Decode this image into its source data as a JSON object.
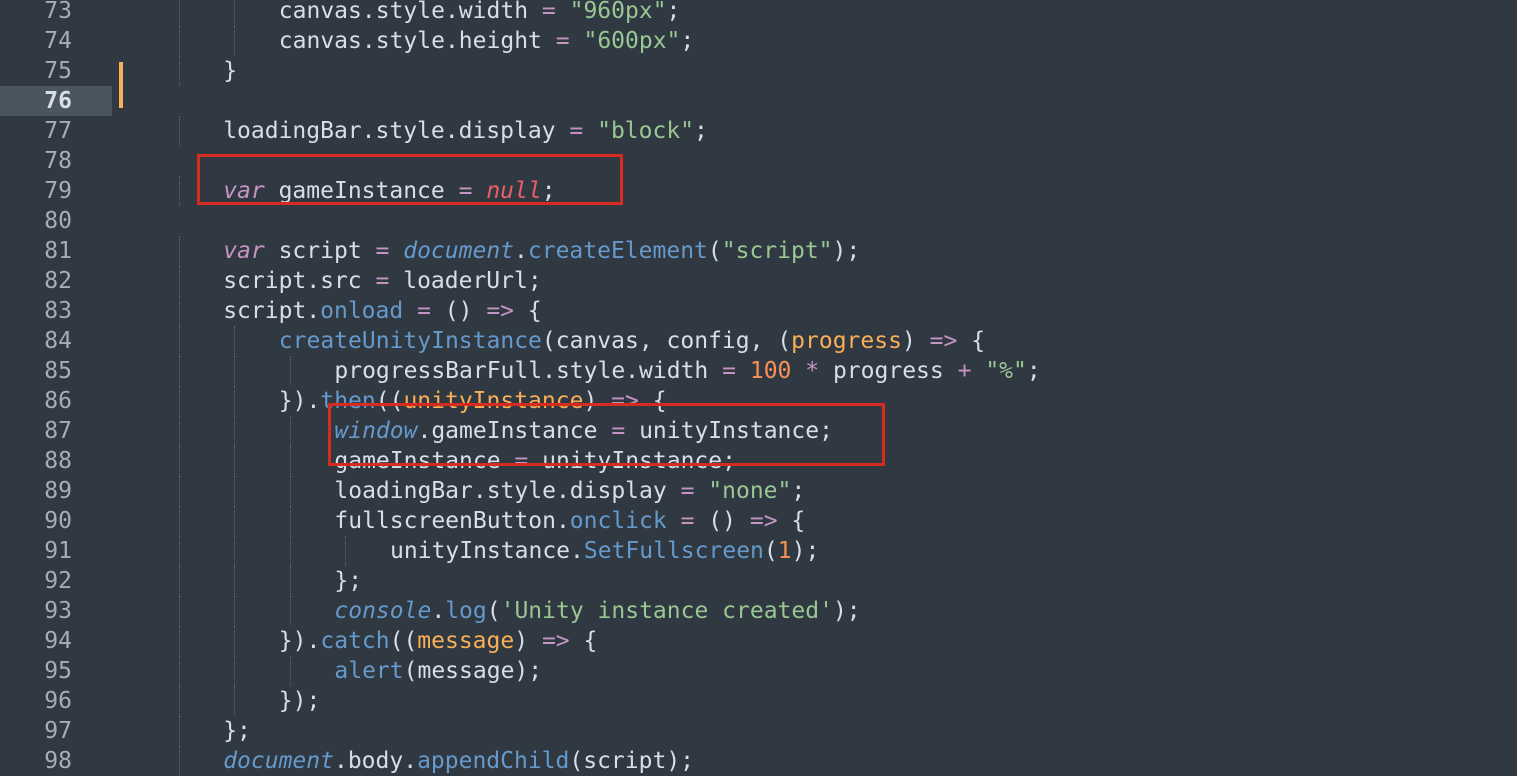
{
  "editor": {
    "first_line_number": 73,
    "current_line": 76,
    "colors": {
      "background": "#303841",
      "highlight_box": "#d62b1f",
      "modified_marker": "#f9ae58"
    },
    "lines": [
      {
        "n": "73",
        "indent": 3,
        "tokens": [
          [
            "pl",
            "canvas.style.width "
          ],
          [
            "op",
            "="
          ],
          [
            "str",
            " \"960px\""
          ],
          [
            "pl",
            ";"
          ]
        ]
      },
      {
        "n": "74",
        "indent": 3,
        "tokens": [
          [
            "pl",
            "canvas.style.height "
          ],
          [
            "op",
            "="
          ],
          [
            "pl",
            " "
          ],
          [
            "str",
            "\"600px\""
          ],
          [
            "pl",
            ";"
          ]
        ]
      },
      {
        "n": "75",
        "indent": 2,
        "tokens": [
          [
            "pl",
            "}"
          ]
        ]
      },
      {
        "n": "76",
        "indent": 0,
        "tokens": []
      },
      {
        "n": "77",
        "indent": 2,
        "tokens": [
          [
            "pl",
            "loadingBar.style.display "
          ],
          [
            "op",
            "="
          ],
          [
            "pl",
            " "
          ],
          [
            "str",
            "\"block\""
          ],
          [
            "pl",
            ";"
          ]
        ]
      },
      {
        "n": "78",
        "indent": 0,
        "tokens": []
      },
      {
        "n": "79",
        "indent": 2,
        "tokens": [
          [
            "kw",
            "var"
          ],
          [
            "pl",
            " gameInstance "
          ],
          [
            "op",
            "="
          ],
          [
            "pl",
            " "
          ],
          [
            "nul",
            "null"
          ],
          [
            "pl",
            ";"
          ]
        ]
      },
      {
        "n": "80",
        "indent": 0,
        "tokens": []
      },
      {
        "n": "81",
        "indent": 2,
        "tokens": [
          [
            "kw",
            "var"
          ],
          [
            "pl",
            " script "
          ],
          [
            "op",
            "="
          ],
          [
            "pl",
            " "
          ],
          [
            "glob",
            "document"
          ],
          [
            "pl",
            "."
          ],
          [
            "fn",
            "createElement"
          ],
          [
            "pl",
            "("
          ],
          [
            "str",
            "\"script\""
          ],
          [
            "pl",
            ");"
          ]
        ]
      },
      {
        "n": "82",
        "indent": 2,
        "tokens": [
          [
            "pl",
            "script.src "
          ],
          [
            "op",
            "="
          ],
          [
            "pl",
            " loaderUrl;"
          ]
        ]
      },
      {
        "n": "83",
        "indent": 2,
        "tokens": [
          [
            "pl",
            "script."
          ],
          [
            "fn",
            "onload"
          ],
          [
            "pl",
            " "
          ],
          [
            "op",
            "="
          ],
          [
            "pl",
            " () "
          ],
          [
            "op",
            "=>"
          ],
          [
            "pl",
            " {"
          ]
        ]
      },
      {
        "n": "84",
        "indent": 3,
        "tokens": [
          [
            "fn",
            "createUnityInstance"
          ],
          [
            "pl",
            "(canvas, config, ("
          ],
          [
            "prm",
            "progress"
          ],
          [
            "pl",
            ") "
          ],
          [
            "op",
            "=>"
          ],
          [
            "pl",
            " {"
          ]
        ]
      },
      {
        "n": "85",
        "indent": 4,
        "tokens": [
          [
            "pl",
            "progressBarFull.style.width "
          ],
          [
            "op",
            "="
          ],
          [
            "pl",
            " "
          ],
          [
            "num",
            "100"
          ],
          [
            "pl",
            " "
          ],
          [
            "op",
            "*"
          ],
          [
            "pl",
            " progress "
          ],
          [
            "op",
            "+"
          ],
          [
            "pl",
            " "
          ],
          [
            "str",
            "\"%\""
          ],
          [
            "pl",
            ";"
          ]
        ]
      },
      {
        "n": "86",
        "indent": 3,
        "tokens": [
          [
            "pl",
            "})."
          ],
          [
            "fn",
            "then"
          ],
          [
            "pl",
            "(("
          ],
          [
            "prm",
            "unityInstance"
          ],
          [
            "pl",
            ") "
          ],
          [
            "op",
            "=>"
          ],
          [
            "pl",
            " {"
          ]
        ]
      },
      {
        "n": "87",
        "indent": 4,
        "tokens": [
          [
            "glob",
            "window"
          ],
          [
            "pl",
            ".gameInstance "
          ],
          [
            "op",
            "="
          ],
          [
            "pl",
            " unityInstance;"
          ]
        ]
      },
      {
        "n": "88",
        "indent": 4,
        "tokens": [
          [
            "pl",
            "gameInstance "
          ],
          [
            "op",
            "="
          ],
          [
            "pl",
            " unityInstance;"
          ]
        ]
      },
      {
        "n": "89",
        "indent": 4,
        "tokens": [
          [
            "pl",
            "loadingBar.style.display "
          ],
          [
            "op",
            "="
          ],
          [
            "pl",
            " "
          ],
          [
            "str",
            "\"none\""
          ],
          [
            "pl",
            ";"
          ]
        ]
      },
      {
        "n": "90",
        "indent": 4,
        "tokens": [
          [
            "pl",
            "fullscreenButton."
          ],
          [
            "fn",
            "onclick"
          ],
          [
            "pl",
            " "
          ],
          [
            "op",
            "="
          ],
          [
            "pl",
            " () "
          ],
          [
            "op",
            "=>"
          ],
          [
            "pl",
            " {"
          ]
        ]
      },
      {
        "n": "91",
        "indent": 5,
        "tokens": [
          [
            "pl",
            "unityInstance."
          ],
          [
            "fn",
            "SetFullscreen"
          ],
          [
            "pl",
            "("
          ],
          [
            "num",
            "1"
          ],
          [
            "pl",
            ");"
          ]
        ]
      },
      {
        "n": "92",
        "indent": 4,
        "tokens": [
          [
            "pl",
            "};"
          ]
        ]
      },
      {
        "n": "93",
        "indent": 4,
        "tokens": [
          [
            "glob",
            "console"
          ],
          [
            "pl",
            "."
          ],
          [
            "fn",
            "log"
          ],
          [
            "pl",
            "("
          ],
          [
            "str",
            "'Unity instance created'"
          ],
          [
            "pl",
            ");"
          ]
        ]
      },
      {
        "n": "94",
        "indent": 3,
        "tokens": [
          [
            "pl",
            "})."
          ],
          [
            "fn",
            "catch"
          ],
          [
            "pl",
            "(("
          ],
          [
            "prm",
            "message"
          ],
          [
            "pl",
            ") "
          ],
          [
            "op",
            "=>"
          ],
          [
            "pl",
            " {"
          ]
        ]
      },
      {
        "n": "95",
        "indent": 4,
        "tokens": [
          [
            "fn",
            "alert"
          ],
          [
            "pl",
            "(message);"
          ]
        ]
      },
      {
        "n": "96",
        "indent": 3,
        "tokens": [
          [
            "pl",
            "});"
          ]
        ]
      },
      {
        "n": "97",
        "indent": 2,
        "tokens": [
          [
            "pl",
            "};"
          ]
        ]
      },
      {
        "n": "98",
        "indent": 2,
        "tokens": [
          [
            "glob",
            "document"
          ],
          [
            "pl",
            ".body."
          ],
          [
            "fn",
            "appendChild"
          ],
          [
            "pl",
            "(script);"
          ]
        ]
      }
    ]
  }
}
